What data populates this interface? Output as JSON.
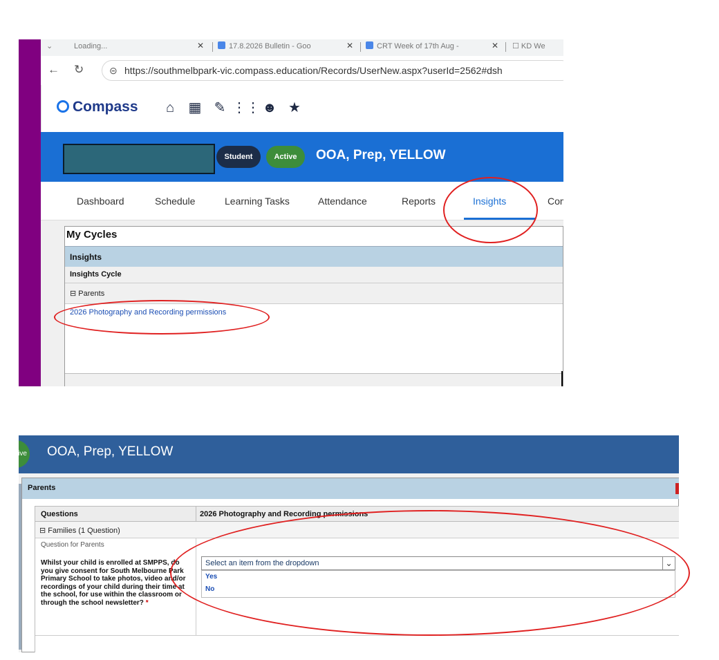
{
  "browser": {
    "tabs": [
      {
        "label": "Loading..."
      },
      {
        "label": "17.8.2026 Bulletin - Goo"
      },
      {
        "label": "CRT Week of 17th Aug -"
      },
      {
        "label": "KD We"
      }
    ],
    "url": "https://southmelbpark-vic.compass.education/Records/UserNew.aspx?userId=2562#dsh"
  },
  "app": {
    "logo": "Compass",
    "nav_icons": [
      "home-icon",
      "calendar-icon",
      "pencil-icon",
      "grid-icon",
      "people-icon",
      "star-icon"
    ]
  },
  "profile": {
    "badge_student": "Student",
    "badge_active": "Active",
    "class_name": "OOA, Prep, YELLOW"
  },
  "tabs": [
    "Dashboard",
    "Schedule",
    "Learning Tasks",
    "Attendance",
    "Reports",
    "Insights",
    "Com"
  ],
  "selected_tab": "Insights",
  "cycles": {
    "title": "My Cycles",
    "header": "Insights",
    "subheader": "Insights Cycle",
    "group": "Parents",
    "link": "2026 Photography and Recording permissions"
  },
  "dialog": {
    "active_fragment": "ive",
    "class_name": "OOA, Prep, YELLOW",
    "title": "Parents",
    "col_questions": "Questions",
    "col_survey": "2026 Photography and Recording permissions",
    "group": "Families (1 Question)",
    "question_label": "Question for Parents",
    "question_text": "Whilst your child is enrolled at SMPPS, do you give consent for South Melbourne Park Primary School to take photos, video and/or recordings of your child during their time at the school, for use within the classroom or through the school newsletter?",
    "required_mark": "*",
    "select_placeholder": "Select an item from the dropdown",
    "options": [
      "Yes",
      "No"
    ]
  },
  "colors": {
    "purple_edge": "#800080",
    "brand_blue": "#1a6fd4",
    "header_blue": "#2f5f9b",
    "active_green": "#3d8d3a",
    "annotation_red": "#e02020"
  }
}
